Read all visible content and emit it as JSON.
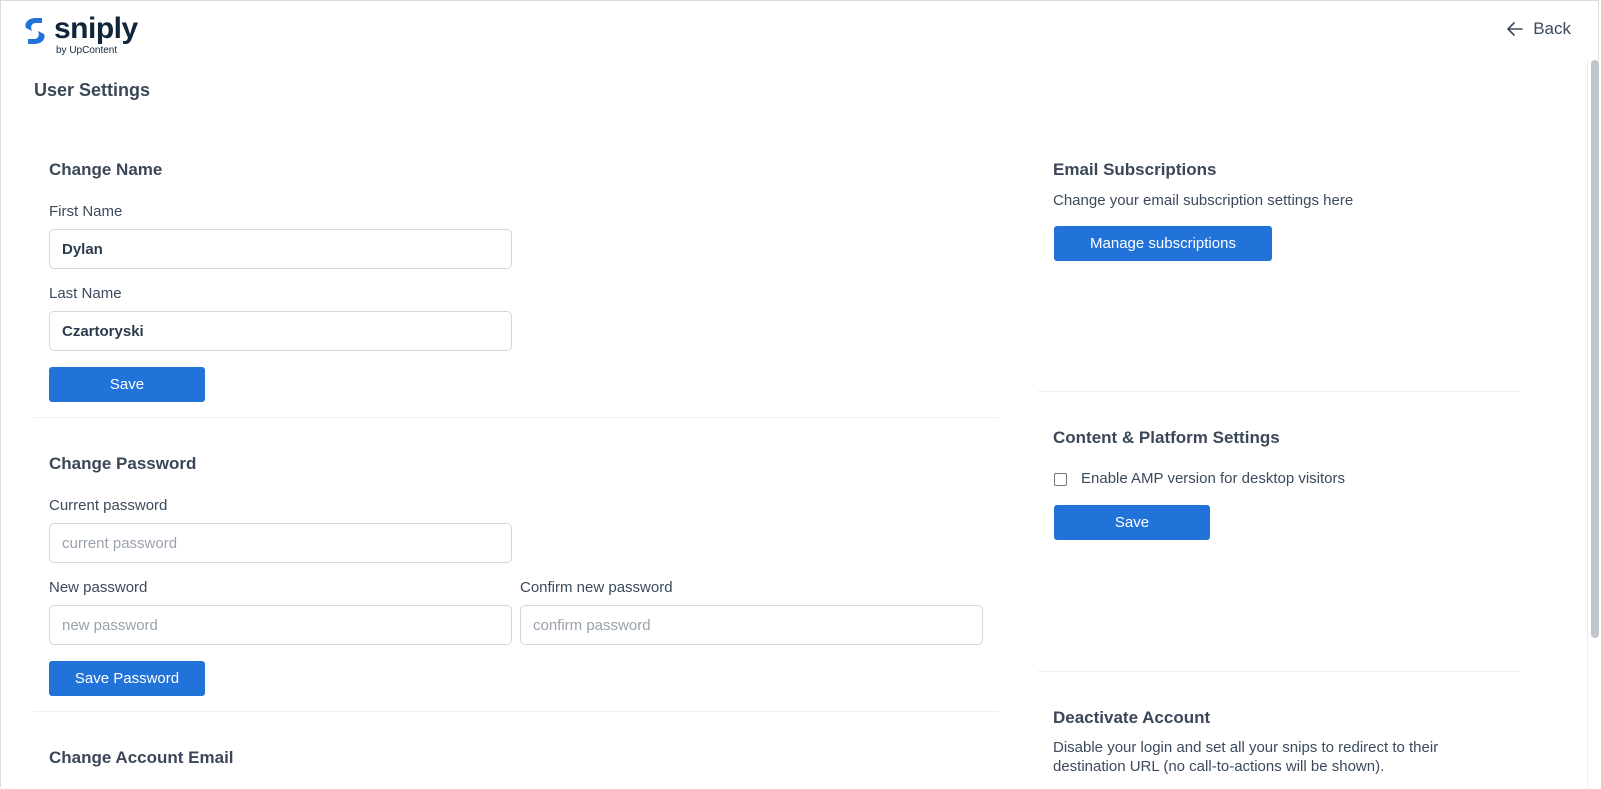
{
  "header": {
    "logo_word": "sniply",
    "logo_sub": "by UpContent",
    "back_label": "Back"
  },
  "page": {
    "title": "User Settings"
  },
  "change_name": {
    "title": "Change Name",
    "first_label": "First Name",
    "first_value": "Dylan",
    "last_label": "Last Name",
    "last_value": "Czartoryski",
    "save_label": "Save"
  },
  "change_password": {
    "title": "Change Password",
    "current_label": "Current password",
    "current_placeholder": "current password",
    "new_label": "New password",
    "new_placeholder": "new password",
    "confirm_label": "Confirm new password",
    "confirm_placeholder": "confirm password",
    "save_label": "Save Password"
  },
  "change_email": {
    "title": "Change Account Email"
  },
  "email_subscriptions": {
    "title": "Email Subscriptions",
    "description": "Change your email subscription settings here",
    "button_label": "Manage subscriptions"
  },
  "content_platform": {
    "title": "Content & Platform Settings",
    "amp_label": "Enable AMP version for desktop visitors",
    "amp_checked": false,
    "save_label": "Save"
  },
  "deactivate": {
    "title": "Deactivate Account",
    "description_line1": "Disable your login and set all your snips to redirect to their",
    "description_line2": "destination URL (no call-to-actions will be shown)."
  },
  "colors": {
    "primary": "#2173d9",
    "brand_dark": "#10243a"
  }
}
